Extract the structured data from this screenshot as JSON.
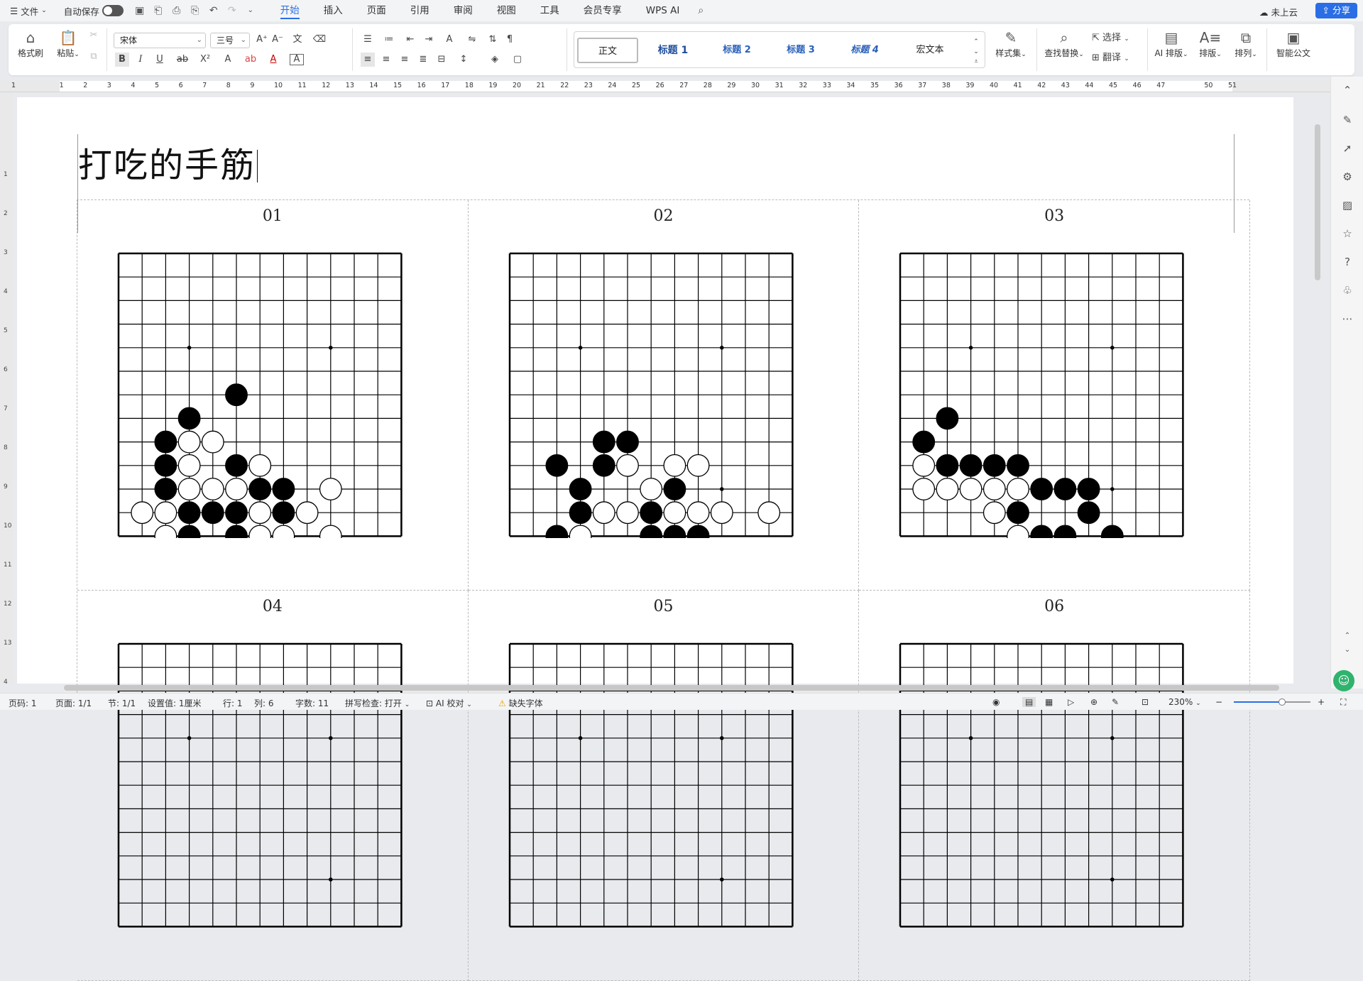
{
  "menubar": {
    "file": "文件",
    "autosave": "自动保存",
    "tabs": [
      "开始",
      "插入",
      "页面",
      "引用",
      "审阅",
      "视图",
      "工具",
      "会员专享",
      "WPS AI"
    ],
    "active_tab": "开始",
    "cloud": "未上云",
    "share": "分享"
  },
  "ribbon": {
    "format_painter": "格式刷",
    "paste": "粘贴",
    "font": "宋体",
    "size": "三号",
    "styles": [
      "正文",
      "标题 1",
      "标题 2",
      "标题 3",
      "标题 4",
      "宏文本"
    ],
    "style_set": "样式集",
    "find_replace": "查找替换",
    "select": "选择",
    "translate": "翻译",
    "ai_layout": "AI 排版",
    "layout": "排版",
    "arrange": "排列",
    "smart_doc": "智能公文"
  },
  "ruler": {
    "marks": [
      "1",
      "1",
      "2",
      "3",
      "4",
      "5",
      "6",
      "7",
      "8",
      "9",
      "10",
      "11",
      "12",
      "13",
      "14",
      "15",
      "16",
      "17",
      "18",
      "19",
      "20",
      "21",
      "22",
      "23",
      "24",
      "25",
      "26",
      "27",
      "28",
      "29",
      "30",
      "31",
      "32",
      "33",
      "34",
      "35",
      "36",
      "37",
      "38",
      "39",
      "40",
      "41",
      "42",
      "43",
      "44",
      "45",
      "46",
      "47",
      "50",
      "51"
    ],
    "vmarks": [
      "1",
      "2",
      "3",
      "4",
      "5",
      "6",
      "7",
      "8",
      "9",
      "10",
      "11",
      "12",
      "13",
      "4"
    ]
  },
  "document": {
    "title": "打吃的手筋",
    "problems": [
      {
        "num": "01",
        "black": [
          [
            5,
            6
          ],
          [
            3,
            7
          ],
          [
            2,
            8
          ],
          [
            2,
            9
          ],
          [
            5,
            9
          ],
          [
            2,
            10
          ],
          [
            6,
            10
          ],
          [
            7,
            10
          ],
          [
            3,
            11
          ],
          [
            4,
            11
          ],
          [
            5,
            11
          ],
          [
            7,
            11
          ],
          [
            3,
            12
          ],
          [
            5,
            12
          ]
        ],
        "white": [
          [
            3,
            8
          ],
          [
            4,
            8
          ],
          [
            3,
            9
          ],
          [
            6,
            9
          ],
          [
            3,
            10
          ],
          [
            4,
            10
          ],
          [
            5,
            10
          ],
          [
            9,
            10
          ],
          [
            1,
            11
          ],
          [
            2,
            11
          ],
          [
            6,
            11
          ],
          [
            8,
            11
          ],
          [
            2,
            12
          ],
          [
            6,
            12
          ],
          [
            7,
            12
          ],
          [
            9,
            12
          ]
        ]
      },
      {
        "num": "02",
        "black": [
          [
            4,
            8
          ],
          [
            5,
            8
          ],
          [
            2,
            9
          ],
          [
            4,
            9
          ],
          [
            3,
            10
          ],
          [
            7,
            10
          ],
          [
            3,
            11
          ],
          [
            6,
            11
          ],
          [
            2,
            12
          ],
          [
            6,
            12
          ],
          [
            7,
            12
          ],
          [
            8,
            12
          ]
        ],
        "white": [
          [
            5,
            9
          ],
          [
            7,
            9
          ],
          [
            8,
            9
          ],
          [
            6,
            10
          ],
          [
            4,
            11
          ],
          [
            5,
            11
          ],
          [
            7,
            11
          ],
          [
            8,
            11
          ],
          [
            9,
            11
          ],
          [
            11,
            11
          ],
          [
            3,
            12
          ]
        ]
      },
      {
        "num": "03",
        "black": [
          [
            2,
            7
          ],
          [
            1,
            8
          ],
          [
            2,
            9
          ],
          [
            3,
            9
          ],
          [
            4,
            9
          ],
          [
            5,
            9
          ],
          [
            6,
            10
          ],
          [
            7,
            10
          ],
          [
            8,
            10
          ],
          [
            5,
            11
          ],
          [
            8,
            11
          ],
          [
            6,
            12
          ],
          [
            7,
            12
          ],
          [
            9,
            12
          ]
        ],
        "white": [
          [
            1,
            9
          ],
          [
            1,
            10
          ],
          [
            2,
            10
          ],
          [
            3,
            10
          ],
          [
            4,
            10
          ],
          [
            5,
            10
          ],
          [
            4,
            11
          ],
          [
            5,
            12
          ]
        ]
      },
      {
        "num": "04",
        "black": [],
        "white": []
      },
      {
        "num": "05",
        "black": [],
        "white": []
      },
      {
        "num": "06",
        "black": [],
        "white": []
      }
    ]
  },
  "status": {
    "page_code": "页码: 1",
    "pages": "页面: 1/1",
    "section": "节: 1/1",
    "setting": "设置值: 1厘米",
    "row": "行: 1",
    "col": "列: 6",
    "words": "字数: 11",
    "spell": "拼写检查: 打开",
    "ai_check": "AI 校对",
    "missing_font": "缺失字体",
    "zoom": "230%"
  },
  "colors": {
    "accent": "#2a6ee6",
    "stone_black": "#000000",
    "stone_white": "#ffffff"
  }
}
